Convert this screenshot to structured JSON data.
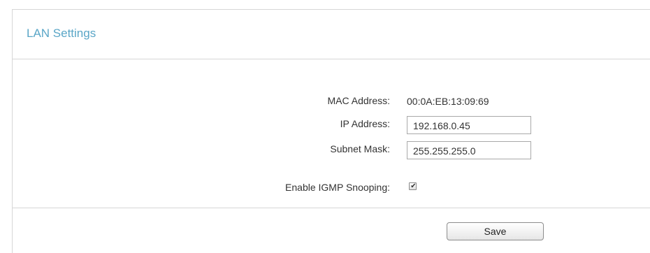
{
  "section": {
    "title": "LAN Settings"
  },
  "form": {
    "mac": {
      "label": "MAC Address:",
      "value": "00:0A:EB:13:09:69"
    },
    "ip": {
      "label": "IP Address:",
      "value": "192.168.0.45"
    },
    "subnet": {
      "label": "Subnet Mask:",
      "value": "255.255.255.0"
    },
    "igmp": {
      "label": "Enable IGMP Snooping:",
      "checked": true
    }
  },
  "actions": {
    "save_label": "Save"
  },
  "colors": {
    "title": "#5aa6c7",
    "divider": "#d6d6d6"
  },
  "icons": {
    "checkmark": "checkmark-icon"
  }
}
